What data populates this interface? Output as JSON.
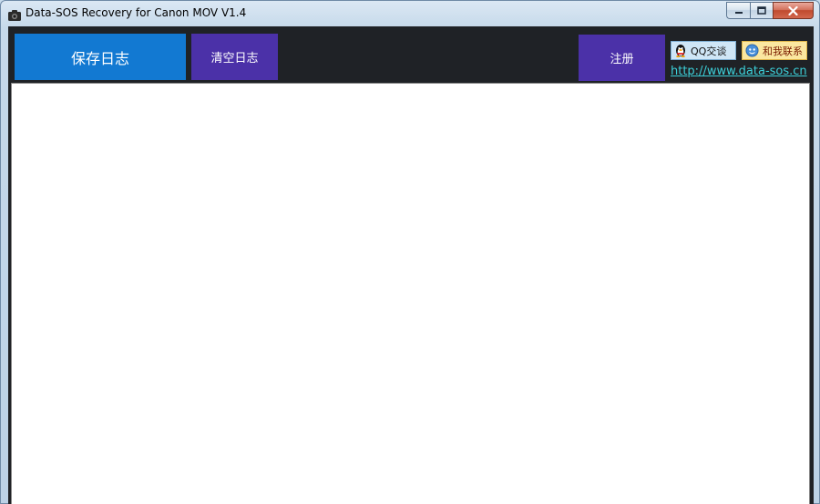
{
  "window": {
    "title": "Data-SOS Recovery for Canon MOV V1.4",
    "controls": {
      "minimize_icon": "minimize-icon",
      "maximize_icon": "maximize-icon",
      "close_icon": "close-icon"
    }
  },
  "toolbar": {
    "save_log_label": "保存日志",
    "clear_log_label": "清空日志",
    "register_label": "注册",
    "qq_chat_label": "QQ交谈",
    "contact_label": "和我联系",
    "website_link": "http://www.data-sos.cn"
  },
  "log": {
    "content": ""
  },
  "colors": {
    "toolbar_bg": "#1f2226",
    "save_button": "#1279d2",
    "secondary_button": "#4b31a8",
    "link": "#3ccfd8"
  }
}
